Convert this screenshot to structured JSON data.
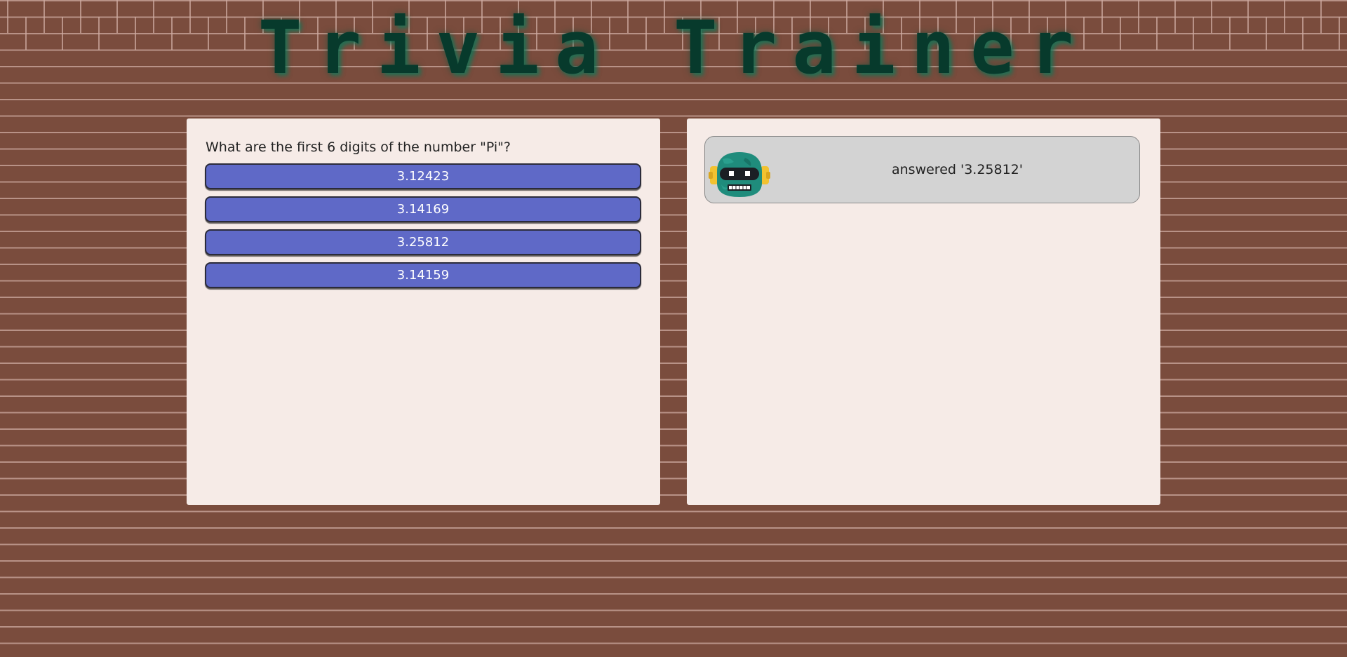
{
  "app": {
    "title": "Trivia Trainer"
  },
  "quiz": {
    "question": "What are the first 6 digits of the number \"Pi\"?",
    "answers": [
      {
        "label": "3.12423"
      },
      {
        "label": "3.14169"
      },
      {
        "label": "3.25812"
      },
      {
        "label": "3.14159"
      }
    ]
  },
  "log": {
    "entries": [
      {
        "avatar_icon": "robot-icon",
        "text": "answered '3.25812'"
      }
    ]
  },
  "colors": {
    "background_brick": "#7a4c3d",
    "mortar": "#cdaaa0",
    "title": "#073a2c",
    "panel": "#f6ebe7",
    "button": "#5f69c7",
    "log_entry": "#d3d3d3",
    "robot": "#1f8c7c",
    "robot_ears": "#f2c230"
  }
}
